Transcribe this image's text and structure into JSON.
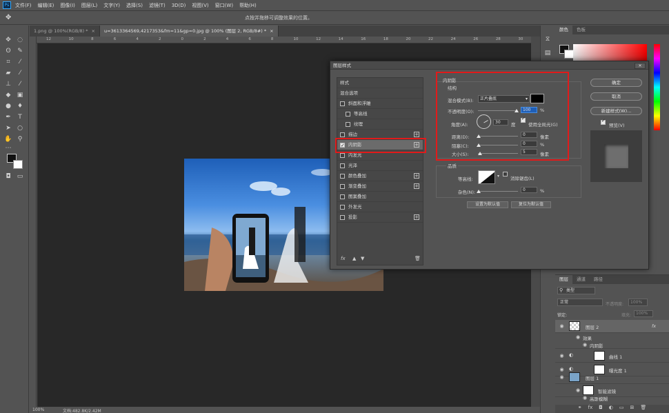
{
  "app": {
    "logo": "Ps"
  },
  "menu": [
    "文件(F)",
    "编辑(E)",
    "图像(I)",
    "图层(L)",
    "文字(Y)",
    "选择(S)",
    "滤镜(T)",
    "3D(D)",
    "视图(V)",
    "窗口(W)",
    "帮助(H)"
  ],
  "options_bar": {
    "hint": "点按并拖移可调整效果的位置。"
  },
  "tabs": [
    {
      "label": "1.png @ 100%(RGB/8) *",
      "close": "×",
      "active": false
    },
    {
      "label": "u=3613364569,4217353&fm=11&gp=0.jpg @ 100% (图层 2, RGB/8#) *",
      "close": "×",
      "active": true
    }
  ],
  "ruler_ticks": [
    "12",
    "10",
    "8",
    "6",
    "4",
    "2",
    "0",
    "2",
    "4",
    "6",
    "8",
    "10",
    "12",
    "14",
    "16",
    "18",
    "20",
    "22",
    "24",
    "26",
    "28",
    "30"
  ],
  "status": {
    "zoom": "100%",
    "doc": "文档:482.8K/2.42M"
  },
  "dialog": {
    "title": "图层样式",
    "close": "✕",
    "styles": [
      {
        "label": "样式",
        "type": "header"
      },
      {
        "label": "混合选项",
        "type": "header"
      },
      {
        "label": "斜面和浮雕",
        "checked": false,
        "indent": false,
        "plus": false
      },
      {
        "label": "等高线",
        "checked": false,
        "indent": true,
        "plus": false
      },
      {
        "label": "纹理",
        "checked": false,
        "indent": true,
        "plus": false
      },
      {
        "label": "描边",
        "checked": false,
        "indent": false,
        "plus": true
      },
      {
        "label": "内阴影",
        "checked": true,
        "indent": false,
        "plus": true,
        "selected": true
      },
      {
        "label": "内发光",
        "checked": false,
        "indent": false,
        "plus": false
      },
      {
        "label": "光泽",
        "checked": false,
        "indent": false,
        "plus": false
      },
      {
        "label": "颜色叠加",
        "checked": false,
        "indent": false,
        "plus": true
      },
      {
        "label": "渐变叠加",
        "checked": false,
        "indent": false,
        "plus": true
      },
      {
        "label": "图案叠加",
        "checked": false,
        "indent": false,
        "plus": false
      },
      {
        "label": "外发光",
        "checked": false,
        "indent": false,
        "plus": false
      },
      {
        "label": "投影",
        "checked": false,
        "indent": false,
        "plus": true
      }
    ],
    "footer_icons": [
      "fx",
      "▲",
      "▼",
      "🗑"
    ],
    "inner_shadow": {
      "section": "内阴影",
      "structure": "结构",
      "blend_label": "混合模式(B):",
      "blend_value": "正片叠底",
      "opacity_label": "不透明度(O):",
      "opacity_value": "100",
      "opacity_unit": "%",
      "opacity_level": 1.0,
      "angle_label": "角度(A):",
      "angle_value": "30",
      "angle_unit": "度",
      "global_light_label": "使用全局光(G)",
      "global_light_checked": true,
      "distance_label": "距离(D):",
      "distance_value": "0",
      "distance_unit": "像素",
      "choke_label": "阻塞(C):",
      "choke_value": "0",
      "choke_unit": "%",
      "size_label": "大小(S):",
      "size_value": "5",
      "size_unit": "像素",
      "shadow_color": "#000000"
    },
    "quality": {
      "section": "品质",
      "contour_label": "等高线:",
      "antialias_label": "消除锯齿(L)",
      "antialias_checked": false,
      "noise_label": "杂色(N):",
      "noise_value": "0",
      "noise_unit": "%"
    },
    "default_buttons": {
      "set": "设置为默认值",
      "reset": "复位为默认值"
    },
    "buttons": {
      "ok": "确定",
      "cancel": "取消",
      "new_style": "新建样式(W)...",
      "preview": "预览(V)",
      "preview_checked": true
    },
    "highlight_color": "#e21a1a"
  },
  "color_panel": {
    "tabs": [
      "颜色",
      "色板"
    ]
  },
  "layers_panel": {
    "tabs": [
      "图层",
      "通道",
      "路径"
    ],
    "search": "类型",
    "blend": "正常",
    "opacity_label": "不透明度:",
    "opacity_value": "100%",
    "lock_label": "锁定:",
    "fill_label": "填充:",
    "fill_value": "100%",
    "layers": [
      {
        "name": "图层 2",
        "fx": "fx",
        "thumb": "checker"
      },
      {
        "name": "效果",
        "sub": true
      },
      {
        "name": "内阴影",
        "sub": true
      },
      {
        "name": "曲线 1",
        "thumb": "white"
      },
      {
        "name": "曝光度 1",
        "thumb": "white"
      },
      {
        "name": "图层 1",
        "thumb": "photo"
      },
      {
        "name": "智能滤镜",
        "sub": true,
        "thumb": "white"
      },
      {
        "name": "高斯模糊",
        "sub": true
      }
    ]
  }
}
